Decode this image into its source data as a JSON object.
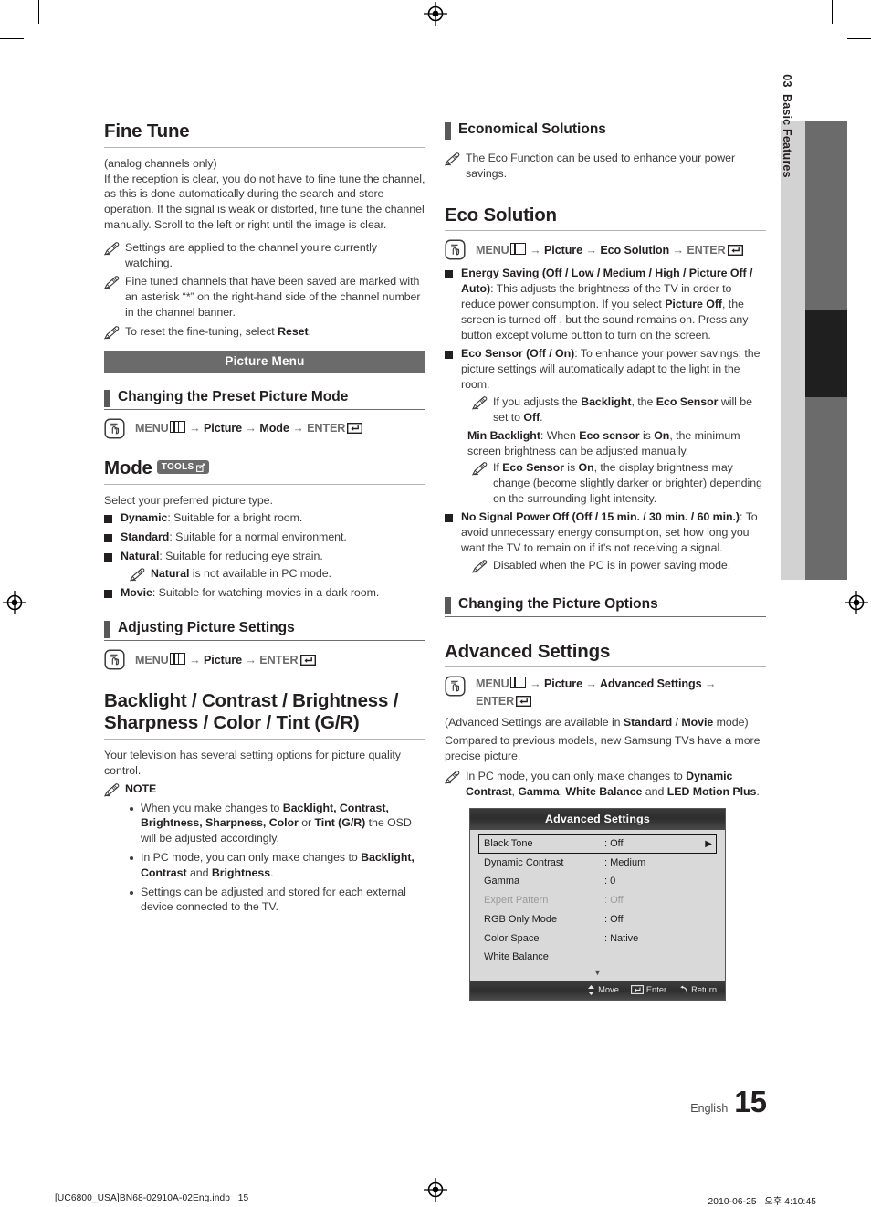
{
  "page": {
    "number": "15",
    "language_label": "English",
    "side_tab": {
      "chapter_number": "03",
      "chapter_title": "Basic Features"
    }
  },
  "imposition_footer": {
    "left": "[UC6800_USA]BN68-02910A-02Eng.indb   15",
    "right": "2010-06-25   오후 4:10:45"
  },
  "left_column": {
    "fine_tune": {
      "title": "Fine Tune",
      "subtitle": "(analog channels only)",
      "paragraph": "If the reception is clear, you do not have to fine tune the channel, as this is done automatically during the search and store operation. If the signal is weak or distorted, fine tune the channel manually. Scroll to the left or right until the image is clear.",
      "notes": [
        "Settings are applied to the channel you're currently watching.",
        "Fine tuned channels that have been saved are marked with an asterisk “*” on the right-hand side of the channel number in the channel banner.",
        "To reset the fine-tuning, select Reset."
      ]
    },
    "picture_menu_band": "Picture Menu",
    "changing_preset": {
      "heading": "Changing the Preset Picture Mode",
      "path": [
        "MENU",
        "Picture",
        "Mode",
        "ENTER"
      ]
    },
    "mode": {
      "title": "Mode",
      "tools_badge": "TOOLS",
      "intro": "Select your preferred picture type.",
      "items": [
        {
          "name": "Dynamic",
          "desc": ": Suitable for a bright room."
        },
        {
          "name": "Standard",
          "desc": ": Suitable for a normal environment."
        },
        {
          "name": "Natural",
          "desc": ": Suitable for reducing eye strain."
        },
        {
          "name": "Movie",
          "desc": ": Suitable for watching movies in a dark room."
        }
      ],
      "natural_note": "Natural is not available in PC mode."
    },
    "adjusting": {
      "heading": "Adjusting Picture Settings",
      "path": [
        "MENU",
        "Picture",
        "ENTER"
      ]
    },
    "backlight": {
      "title": "Backlight / Contrast / Brightness / Sharpness / Color / Tint (G/R)",
      "paragraph": "Your television has several setting options for picture quality control.",
      "note_label": "NOTE",
      "bullets": [
        "When you make changes to Backlight, Contrast, Brightness, Sharpness, Color or Tint (G/R) the OSD will be adjusted accordingly.",
        "In PC mode, you can only make changes to Backlight, Contrast and Brightness.",
        "Settings can be adjusted and stored for each external device connected to the TV."
      ]
    }
  },
  "right_column": {
    "economical": {
      "heading": "Economical Solutions",
      "note": "The Eco Function can be used to enhance your power savings."
    },
    "eco_solution": {
      "title": "Eco Solution",
      "path": [
        "MENU",
        "Picture",
        "Eco Solution",
        "ENTER"
      ],
      "energy_saving": {
        "label": "Energy Saving (Off / Low / Medium / High / Picture Off / Auto)",
        "desc": ": This adjusts the brightness of the TV in order to reduce power consumption. If you select Picture Off, the screen is turned off , but the sound remains on. Press any button except volume button to turn on the screen."
      },
      "eco_sensor": {
        "label": "Eco Sensor (Off / On)",
        "desc": ": To enhance your power savings; the picture settings will automatically adapt to the light in the room.",
        "note": "If you adjusts the Backlight, the Eco Sensor will be set to Off."
      },
      "min_backlight": {
        "label": "Min Backlight",
        "desc": ": When Eco sensor is On, the minimum screen brightness can be adjusted manually.",
        "note": "If Eco Sensor is On, the display brightness may change (become slightly darker or brighter) depending on the surrounding light intensity."
      },
      "no_signal": {
        "label": "No Signal Power Off (Off / 15 min. / 30 min. / 60 min.)",
        "desc": ": To avoid unnecessary energy consumption, set how long you want the TV to remain on if it's not receiving a signal.",
        "note": "Disabled when the PC is in power saving mode."
      }
    },
    "changing_options": {
      "heading": "Changing the Picture Options"
    },
    "advanced_settings": {
      "title": "Advanced Settings",
      "path": [
        "MENU",
        "Picture",
        "Advanced Settings",
        "ENTER"
      ],
      "availability": "(Advanced Settings are available in Standard / Movie mode)",
      "paragraph": "Compared to previous models, new Samsung TVs have a more precise picture.",
      "note": "In PC mode, you can only make changes to Dynamic Contrast, Gamma, White Balance and LED Motion Plus."
    },
    "osd": {
      "title": "Advanced Settings",
      "rows": [
        {
          "label": "Black Tone",
          "value": ": Off",
          "selected": true,
          "dim": false,
          "caret": "▶"
        },
        {
          "label": "Dynamic Contrast",
          "value": ": Medium",
          "selected": false,
          "dim": false,
          "caret": ""
        },
        {
          "label": "Gamma",
          "value": ": 0",
          "selected": false,
          "dim": false,
          "caret": ""
        },
        {
          "label": "Expert Pattern",
          "value": ": Off",
          "selected": false,
          "dim": true,
          "caret": ""
        },
        {
          "label": "RGB Only Mode",
          "value": ": Off",
          "selected": false,
          "dim": false,
          "caret": ""
        },
        {
          "label": "Color Space",
          "value": ": Native",
          "selected": false,
          "dim": false,
          "caret": ""
        },
        {
          "label": "White Balance",
          "value": "",
          "selected": false,
          "dim": false,
          "caret": ""
        }
      ],
      "more_indicator": "▼",
      "footer": {
        "move": "Move",
        "enter": "Enter",
        "return": "Return"
      }
    }
  }
}
